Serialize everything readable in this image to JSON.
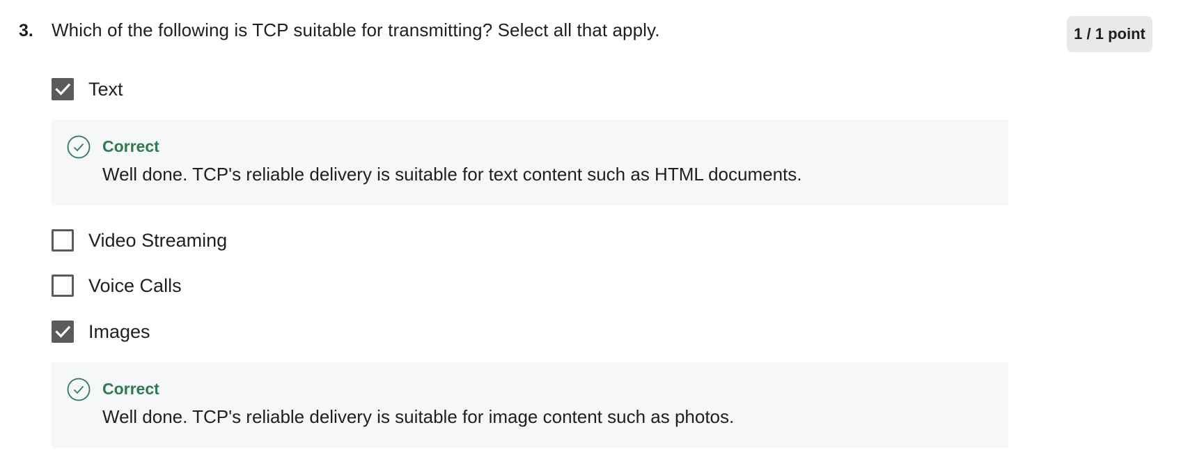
{
  "question": {
    "number": "3.",
    "text": "Which of the following is TCP suitable for transmitting? Select all that apply.",
    "points": "1 / 1 point"
  },
  "options": [
    {
      "label": "Text",
      "checked": true
    },
    {
      "label": "Video Streaming",
      "checked": false
    },
    {
      "label": "Voice Calls",
      "checked": false
    },
    {
      "label": "Images",
      "checked": true
    }
  ],
  "feedback": [
    {
      "status": "Correct",
      "message": "Well done. TCP's reliable delivery is suitable for text content such as HTML documents."
    },
    {
      "status": "Correct",
      "message": "Well done. TCP's reliable delivery is suitable for image content such as photos."
    }
  ],
  "colors": {
    "correct_green": "#2e7a4e",
    "checkbox_fill": "#5b5b5b",
    "feedback_bg": "#f5f7f8",
    "badge_bg": "#e8e9eb"
  },
  "icons": {
    "check_mark": "check-icon",
    "correct": "check-circle-icon"
  }
}
